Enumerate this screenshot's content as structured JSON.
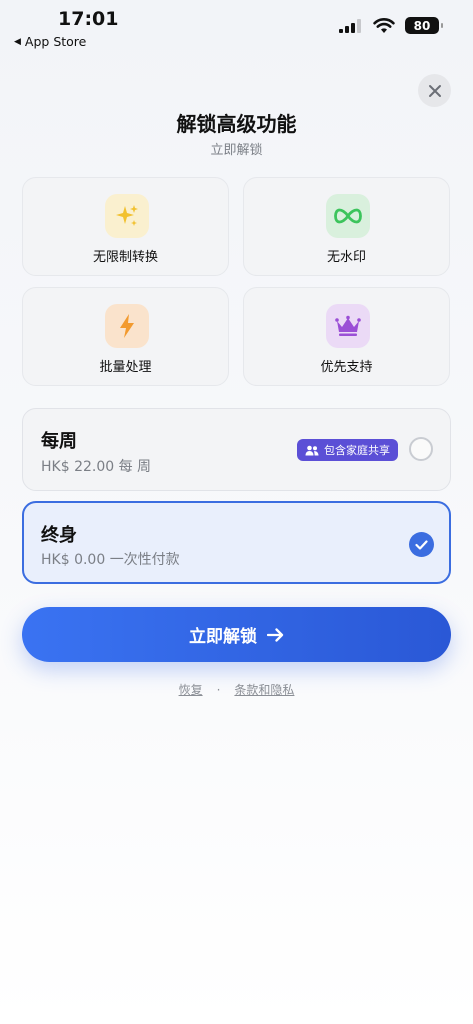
{
  "status_bar": {
    "time": "17:01",
    "back_label": "App Store",
    "battery": "80"
  },
  "header": {
    "title": "解锁高级功能",
    "subtitle": "立即解锁"
  },
  "features": [
    {
      "label": "无限制转换",
      "icon": "sparkles-icon",
      "color": "#f2c12e",
      "bg": "#faf0cf"
    },
    {
      "label": "无水印",
      "icon": "infinity-icon",
      "color": "#3cc45c",
      "bg": "#d9f0dd"
    },
    {
      "label": "批量处理",
      "icon": "bolt-icon",
      "color": "#f29a2e",
      "bg": "#fae3cc"
    },
    {
      "label": "优先支持",
      "icon": "crown-icon",
      "color": "#9b4fd6",
      "bg": "#ebdaf6"
    }
  ],
  "plans": {
    "weekly": {
      "name": "每周",
      "price": "HK$ 22.00 每 周",
      "badge": "包含家庭共享",
      "selected": false
    },
    "lifetime": {
      "name": "终身",
      "price": "HK$ 0.00 一次性付款",
      "selected": true
    }
  },
  "cta": {
    "label": "立即解锁"
  },
  "footer": {
    "restore": "恢复",
    "separator": "·",
    "terms": "条款和隐私"
  },
  "colors": {
    "accent": "#3b6de0",
    "badge": "#5b4fd6"
  }
}
